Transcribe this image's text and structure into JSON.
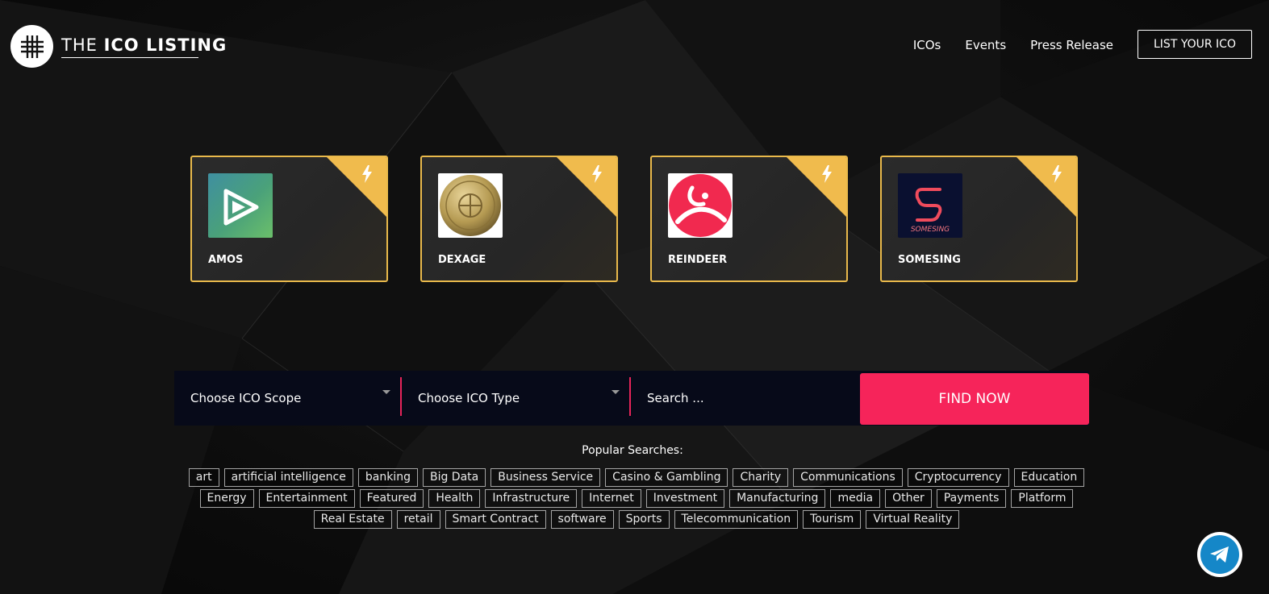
{
  "header": {
    "logo_text_light": "THE",
    "logo_text_bold": "ICO LISTING",
    "nav": [
      "ICOs",
      "Events",
      "Press Release"
    ],
    "cta_label": "LIST YOUR ICO"
  },
  "featured": [
    {
      "name": "AMOS",
      "logo_text": "AMOS"
    },
    {
      "name": "DEXAGE",
      "logo_text": ""
    },
    {
      "name": "REINDEER",
      "logo_text": ""
    },
    {
      "name": "SOMESING",
      "logo_text": "SOMESING"
    }
  ],
  "search": {
    "scope_label": "Choose ICO Scope",
    "type_label": "Choose ICO Type",
    "placeholder": "Search ...",
    "button_label": "FIND NOW"
  },
  "popular": {
    "title": "Popular Searches:",
    "tags": [
      "art",
      "artificial intelligence",
      "banking",
      "Big Data",
      "Business Service",
      "Casino & Gambling",
      "Charity",
      "Communications",
      "Cryptocurrency",
      "Education",
      "Energy",
      "Entertainment",
      "Featured",
      "Health",
      "Infrastructure",
      "Internet",
      "Investment",
      "Manufacturing",
      "media",
      "Other",
      "Payments",
      "Platform",
      "Real Estate",
      "retail",
      "Smart Contract",
      "software",
      "Sports",
      "Telecommunication",
      "Tourism",
      "Virtual Reality"
    ]
  },
  "colors": {
    "accent_gold": "#f0bb4d",
    "accent_pink": "#f6245a",
    "search_bg": "#070a19",
    "telegram_blue": "#1587c8"
  }
}
